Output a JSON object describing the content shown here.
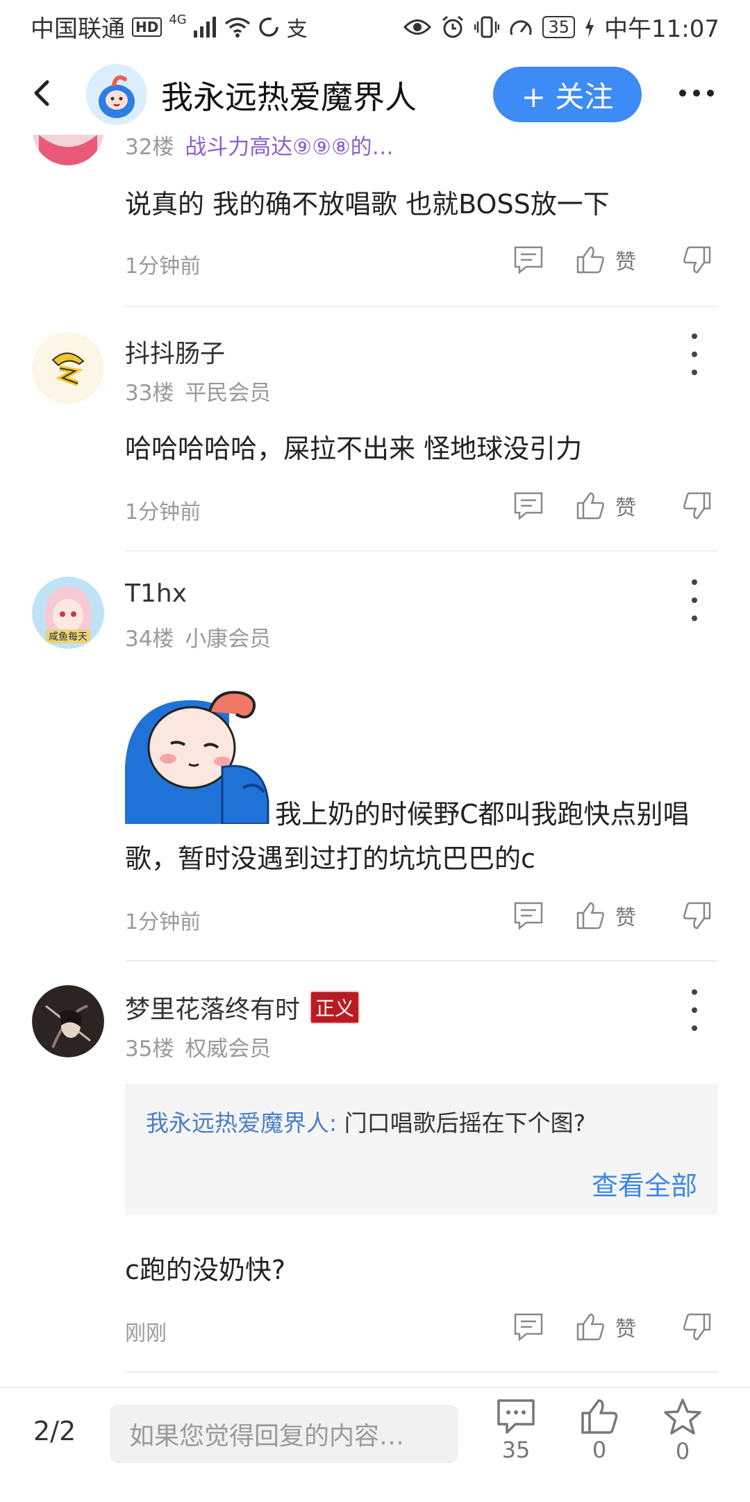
{
  "status_bar": {
    "carrier": "中国联通",
    "hd": "HD",
    "signal": "4G",
    "battery": "35",
    "time": "中午11:07"
  },
  "header": {
    "title": "我永远热爱魔界人",
    "follow_label": "+ 关注"
  },
  "posts": [
    {
      "floor": "32楼",
      "badge": "战斗力高达⑨⑨⑧的…",
      "content": "说真的 我的确不放唱歌 也就BOSS放一下",
      "time": "1分钟前",
      "like_label": "赞"
    },
    {
      "name": "抖抖肠子",
      "floor": "33楼",
      "level": "平民会员",
      "content": "哈哈哈哈哈，屎拉不出来 怪地球没引力",
      "time": "1分钟前",
      "like_label": "赞"
    },
    {
      "name": "T1hx",
      "floor": "34楼",
      "level": "小康会员",
      "content_line1": "我上奶的时候野C都叫我跑快点别唱",
      "content_line2": "歌，暂时没遇到过打的坑坑巴巴的c",
      "avatar_text": "咸鱼每天",
      "time": "1分钟前",
      "like_label": "赞"
    },
    {
      "name": "梦里花落终有时",
      "name_badge": "正义",
      "floor": "35楼",
      "level": "权威会员",
      "quote_author": "我永远热爱魔界人:",
      "quote_text": "门口唱歌后摇在下个图?",
      "view_all": "查看全部",
      "content": "c跑的没奶快?",
      "time": "刚刚",
      "like_label": "赞"
    }
  ],
  "bottom_bar": {
    "page": "2/2",
    "placeholder": "如果您觉得回复的内容…",
    "comments": "35",
    "likes": "0",
    "favorites": "0"
  }
}
